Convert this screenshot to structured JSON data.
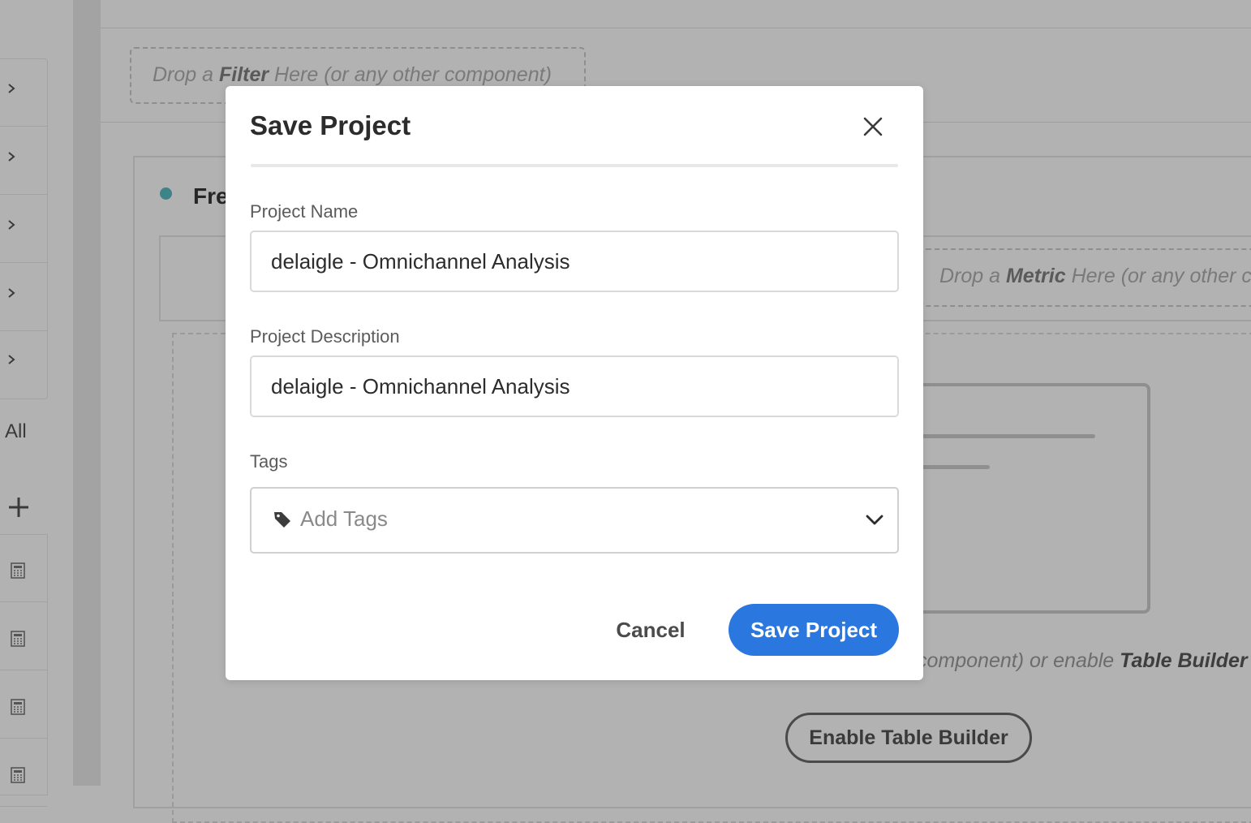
{
  "background": {
    "filter_drop": {
      "prefix": "Drop a ",
      "keyword": "Filter",
      "suffix": " Here (or any other component)"
    },
    "panel_title": "Fre",
    "metric_drop": {
      "prefix": "Drop a ",
      "keyword": "Metric",
      "suffix": " Here (or any other co"
    },
    "hint": {
      "prefix": "component) or enable ",
      "keyword": "Table Builder"
    },
    "enable_button_label": "Enable Table Builder",
    "rail_all_label": "All",
    "rail_icons": [
      "chevron-right-icon",
      "plus-icon",
      "calculator-icon"
    ]
  },
  "modal": {
    "title": "Save Project",
    "close_icon": "close-icon",
    "project_name": {
      "label": "Project Name",
      "value": "delaigle - Omnichannel Analysis"
    },
    "project_description": {
      "label": "Project Description",
      "value": "delaigle - Omnichannel Analysis"
    },
    "tags": {
      "label": "Tags",
      "placeholder": "Add Tags",
      "icon": "tag-icon",
      "dropdown_icon": "chevron-down-icon"
    },
    "cancel_label": "Cancel",
    "save_label": "Save Project"
  },
  "colors": {
    "primary": "#2b77e0",
    "panel_dot": "#3e8388",
    "overlay": "#b2b2b2"
  }
}
